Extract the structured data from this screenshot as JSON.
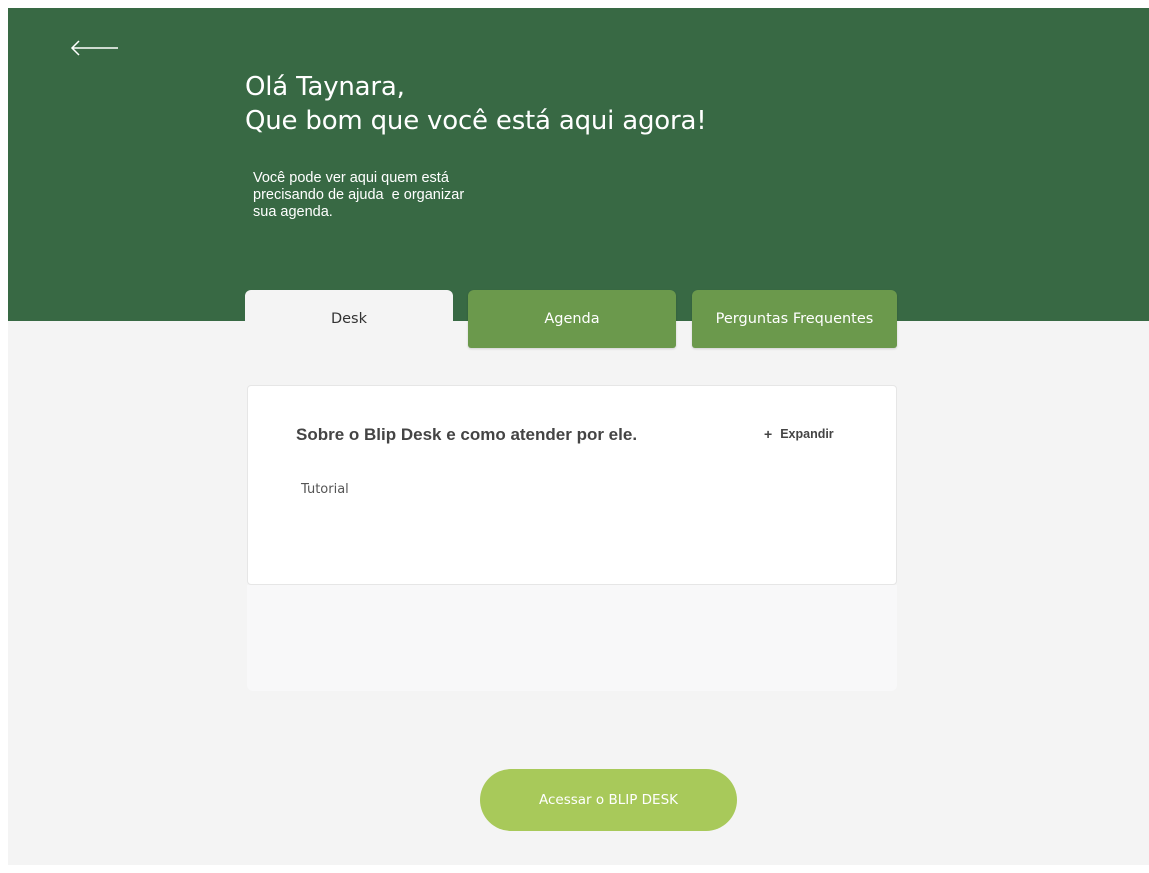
{
  "header": {
    "back_icon": "arrow-left-icon",
    "greeting_line1": "Olá Taynara,",
    "greeting_line2": "Que bom que você está aqui agora!",
    "intro_line1": "Você pode ver aqui quem está",
    "intro_line2": "precisando de ajuda  e organizar",
    "intro_line3": "sua agenda.",
    "background_color": "#386944"
  },
  "tabs": [
    {
      "label": "Desk",
      "active": true
    },
    {
      "label": "Agenda",
      "active": false
    },
    {
      "label": "Perguntas Frequentes",
      "active": false
    }
  ],
  "card": {
    "title": "Sobre o Blip Desk e como atender por ele.",
    "expand_icon": "plus-icon",
    "expand_symbol": "+",
    "expand_label": "Expandir",
    "subtitle": "Tutorial"
  },
  "cta": {
    "label": "Acessar o BLIP DESK",
    "color": "#a8c95a"
  },
  "colors": {
    "tab_inactive": "#6b994c",
    "tab_active": "#f4f4f4",
    "page_background": "#f4f4f4"
  }
}
